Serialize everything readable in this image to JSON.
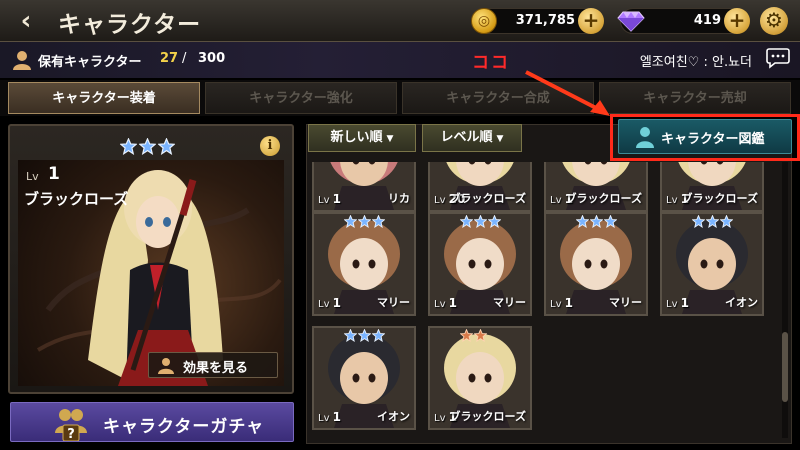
{
  "header": {
    "back_glyph": "‹",
    "title": "キャラクター",
    "gold": "371,785",
    "gems": "419",
    "plus_glyph": "+",
    "settings_glyph": "⚙"
  },
  "subbar": {
    "owned_label": "保有キャラクター",
    "owned_count": "27",
    "owned_sep": "/",
    "owned_max": "300",
    "annotation": "ココ",
    "player_name": "엘조여친♡ : 안.뇨더"
  },
  "tabs": [
    {
      "label": "キャラクター装着",
      "active": true
    },
    {
      "label": "キャラクター強化",
      "active": false
    },
    {
      "label": "キャラクター合成",
      "active": false
    },
    {
      "label": "キャラクター売却",
      "active": false
    }
  ],
  "selected": {
    "lv_label": "Lv",
    "level": "1",
    "name": "ブラックローズ",
    "stars": 3,
    "info_glyph": "i",
    "effect_button": "効果を見る"
  },
  "gacha_button": "キャラクターガチャ",
  "sort": {
    "newest": "新しい順",
    "level": "レベル順",
    "caret": "▼"
  },
  "encyclopedia_button": "キャラクター図鑑",
  "cards": [
    {
      "level": "1",
      "name": "リカ",
      "stars": 3,
      "star_color": "blue",
      "hair": "#c87a7a",
      "skin": "#e8c8a8"
    },
    {
      "level": "20",
      "name": "ブラックローズ",
      "stars": 3,
      "star_color": "blue",
      "hair": "#e8d8a0",
      "skin": "#f0d8c0"
    },
    {
      "level": "1",
      "name": "ブラックローズ",
      "stars": 3,
      "star_color": "blue",
      "hair": "#e8d8a0",
      "skin": "#f0d8c0"
    },
    {
      "level": "1",
      "name": "ブラックローズ",
      "stars": 3,
      "star_color": "blue",
      "hair": "#e8d8a0",
      "skin": "#f0d8c0"
    },
    {
      "level": "1",
      "name": "マリー",
      "stars": 3,
      "star_color": "blue",
      "hair": "#9a6a48",
      "skin": "#f0dcc8"
    },
    {
      "level": "1",
      "name": "マリー",
      "stars": 3,
      "star_color": "blue",
      "hair": "#9a6a48",
      "skin": "#f0dcc8"
    },
    {
      "level": "1",
      "name": "マリー",
      "stars": 3,
      "star_color": "blue",
      "hair": "#9a6a48",
      "skin": "#f0dcc8"
    },
    {
      "level": "1",
      "name": "イオン",
      "stars": 3,
      "star_color": "blue",
      "hair": "#2a2a30",
      "skin": "#e8c8a8"
    },
    {
      "level": "1",
      "name": "イオン",
      "stars": 3,
      "star_color": "blue",
      "hair": "#2a2a30",
      "skin": "#e8c8a8"
    },
    {
      "level": "1",
      "name": "ブラックローズ",
      "stars": 2,
      "star_color": "bronze",
      "hair": "#e8d8a0",
      "skin": "#f0d8c0"
    }
  ]
}
